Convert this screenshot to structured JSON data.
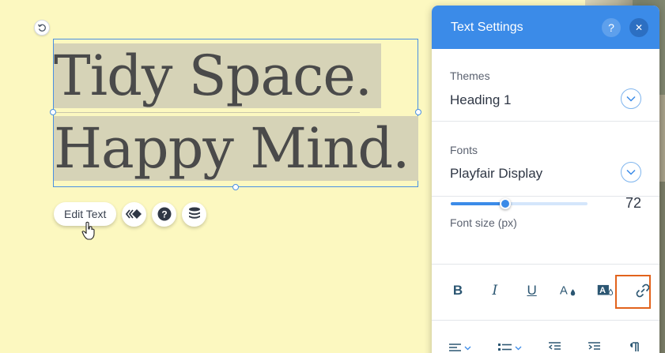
{
  "canvas": {
    "heading_line1": "Tidy Space.",
    "heading_line2": "Happy Mind.",
    "edit_text_label": "Edit Text"
  },
  "panel": {
    "title": "Text Settings",
    "help_icon": "?",
    "close_icon": "✕",
    "themes_label": "Themes",
    "themes_value": "Heading 1",
    "fonts_label": "Fonts",
    "fonts_value": "Playfair Display",
    "font_size_label": "Font size (px)",
    "font_size_value": "72",
    "font_size_fraction": 0.4
  },
  "format_buttons": {
    "bold": "B",
    "italic": "I",
    "underline": "U"
  },
  "colors": {
    "panel_header": "#3b8be8",
    "canvas_bg": "#fcf8c0",
    "text_highlight": "#d6d3b7",
    "selection_border": "#4a90e2",
    "link_highlight": "#e2631c"
  }
}
